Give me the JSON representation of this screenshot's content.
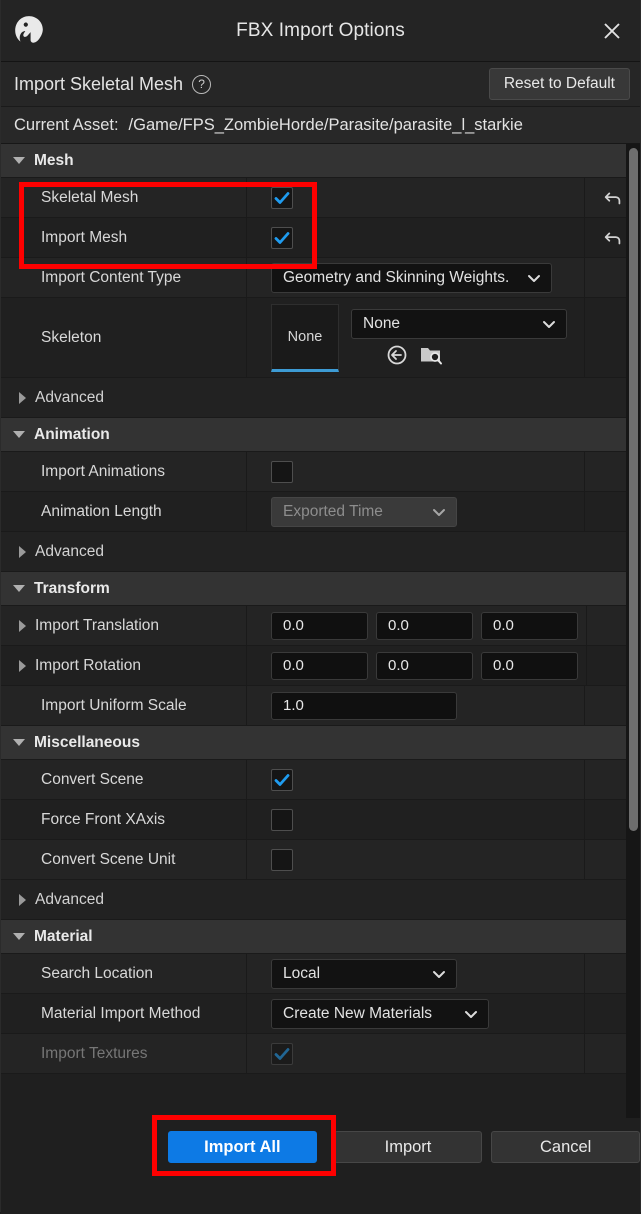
{
  "window": {
    "title": "FBX Import Options",
    "logo_icon": "unreal-engine-logo",
    "close_icon": "close-icon"
  },
  "subheader": {
    "title": "Import Skeletal Mesh",
    "help_icon": "question-mark-icon",
    "reset_label": "Reset to Default"
  },
  "asset": {
    "label": "Current Asset:",
    "path": "/Game/FPS_ZombieHorde/Parasite/parasite_l_starkie"
  },
  "sections": {
    "mesh": {
      "title": "Mesh",
      "skeletal_mesh": {
        "label": "Skeletal Mesh",
        "checked": true,
        "reset_icon": "undo-arrow-icon"
      },
      "import_mesh": {
        "label": "Import Mesh",
        "checked": true,
        "reset_icon": "undo-arrow-icon"
      },
      "import_content_type": {
        "label": "Import Content Type",
        "value": "Geometry and Skinning Weights."
      },
      "skeleton": {
        "label": "Skeleton",
        "thumb_value": "None",
        "combo_value": "None",
        "use_selected_icon": "use-selected-asset-icon",
        "browse_icon": "browse-to-asset-icon"
      },
      "advanced": "Advanced"
    },
    "animation": {
      "title": "Animation",
      "import_animations": {
        "label": "Import Animations",
        "checked": false
      },
      "animation_length": {
        "label": "Animation Length",
        "value": "Exported Time",
        "disabled": true
      },
      "advanced": "Advanced"
    },
    "transform": {
      "title": "Transform",
      "import_translation": {
        "label": "Import Translation",
        "values": [
          "0.0",
          "0.0",
          "0.0"
        ]
      },
      "import_rotation": {
        "label": "Import Rotation",
        "values": [
          "0.0",
          "0.0",
          "0.0"
        ]
      },
      "import_uniform_scale": {
        "label": "Import Uniform Scale",
        "value": "1.0"
      }
    },
    "miscellaneous": {
      "title": "Miscellaneous",
      "convert_scene": {
        "label": "Convert Scene",
        "checked": true
      },
      "force_front_xaxis": {
        "label": "Force Front XAxis",
        "checked": false
      },
      "convert_scene_unit": {
        "label": "Convert Scene Unit",
        "checked": false
      },
      "advanced": "Advanced"
    },
    "material": {
      "title": "Material",
      "search_location": {
        "label": "Search Location",
        "value": "Local"
      },
      "material_import_method": {
        "label": "Material Import Method",
        "value": "Create New Materials"
      },
      "import_textures": {
        "label": "Import Textures",
        "checked": true,
        "disabled": true
      }
    }
  },
  "footer": {
    "import_all": "Import All",
    "import": "Import",
    "cancel": "Cancel"
  },
  "colors": {
    "accent_blue": "#0d7ae5",
    "checkbox_blue": "#1f9cf0",
    "annotation_red": "#fe0000",
    "thumb_underline": "#3d9bd4"
  },
  "scrollbar": {
    "position_percent": 0
  }
}
